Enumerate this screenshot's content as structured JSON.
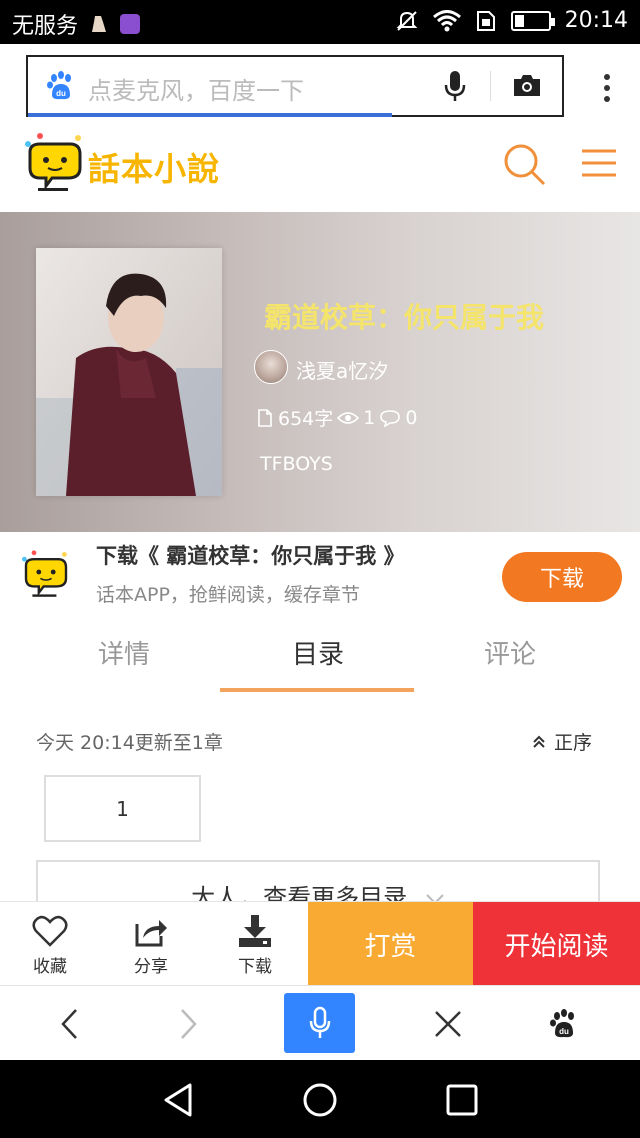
{
  "status_bar": {
    "carrier": "无服务",
    "time": "20:14",
    "icons": [
      "app-notification-icon",
      "gallery-notification-icon",
      "mute-icon",
      "wifi-icon",
      "sim-icon",
      "battery-icon"
    ]
  },
  "browser": {
    "search_placeholder": "点麦克风，百度一下",
    "icons": [
      "baidu-paw-icon",
      "microphone-icon",
      "camera-icon",
      "more-vertical-icon"
    ]
  },
  "site": {
    "logo_text": "話本小說",
    "icons": [
      "search-icon",
      "menu-icon"
    ]
  },
  "book": {
    "title": "霸道校草：你只属于我",
    "author": "浅夏a忆汐",
    "word_count": "654字",
    "views": "1",
    "comments": "0",
    "tag": "TFBOYS"
  },
  "download_banner": {
    "title": "下载《 霸道校草：你只属于我 》",
    "subtitle": "话本APP，抢鲜阅读，缓存章节",
    "button": "下载"
  },
  "tabs": [
    {
      "label": "详情",
      "active": false
    },
    {
      "label": "目录",
      "active": true
    },
    {
      "label": "评论",
      "active": false
    }
  ],
  "catalog": {
    "update_text": "今天 20:14更新至1章",
    "order_label": "正序",
    "chapters": [
      "1"
    ],
    "more_label": "大人，查看更多目录"
  },
  "actions": {
    "collect": "收藏",
    "share": "分享",
    "download": "下载",
    "reward": "打赏",
    "start_reading": "开始阅读"
  },
  "colors": {
    "accent_orange": "#f27821",
    "reward_yellow": "#f8aa32",
    "read_red": "#ef3238",
    "baidu_blue": "#3385ff",
    "title_yellow": "#f4e46b"
  }
}
